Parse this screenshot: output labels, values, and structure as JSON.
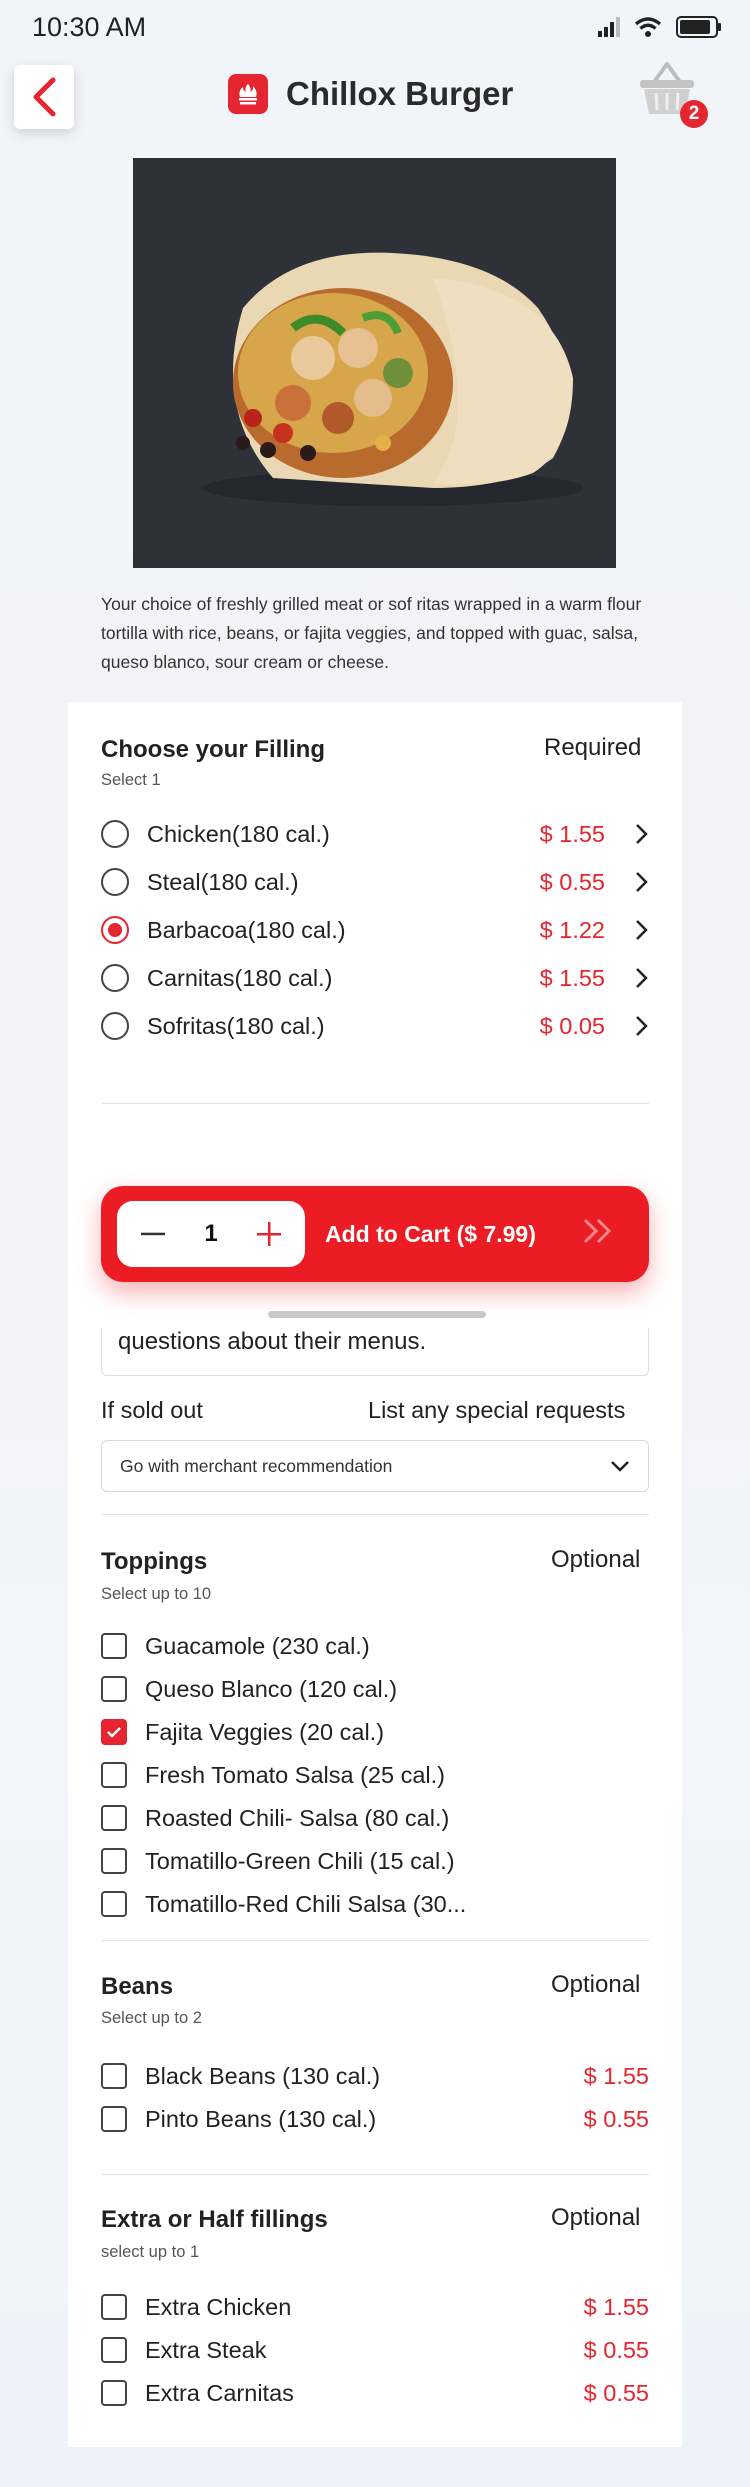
{
  "status": {
    "time": "10:30 AM"
  },
  "header": {
    "title": "Chillox Burger",
    "cart_count": "2"
  },
  "product": {
    "description": "Your choice of freshly grilled meat or sof ritas wrapped in a warm flour tortilla with rice, beans, or fajita veggies, and topped with guac, salsa, queso blanco, sour cream or cheese."
  },
  "filling": {
    "title": "Choose your Filling",
    "subtitle": "Select 1",
    "tag": "Required",
    "options": [
      {
        "label": "Chicken(180 cal.)",
        "price": "$ 1.55",
        "selected": false
      },
      {
        "label": "Steal(180 cal.)",
        "price": "$ 0.55",
        "selected": false
      },
      {
        "label": "Barbacoa(180 cal.)",
        "price": "$ 1.22",
        "selected": true
      },
      {
        "label": "Carnitas(180 cal.)",
        "price": "$ 1.55",
        "selected": false
      },
      {
        "label": "Sofritas(180 cal.)",
        "price": "$ 0.05",
        "selected": false
      }
    ]
  },
  "cart_bar": {
    "quantity": "1",
    "add_label": "Add to Cart ($ 7.99)"
  },
  "notes": {
    "text": "questions about their menus."
  },
  "sold_out": {
    "label": "If sold out",
    "requests_label": "List any special requests",
    "value": "Go with merchant recommendation"
  },
  "toppings": {
    "title": "Toppings",
    "subtitle": "Select up to 10",
    "tag": "Optional",
    "options": [
      {
        "label": "Guacamole (230 cal.)",
        "checked": false
      },
      {
        "label": "Queso Blanco (120 cal.)",
        "checked": false
      },
      {
        "label": "Fajita Veggies (20 cal.)",
        "checked": true
      },
      {
        "label": "Fresh Tomato Salsa (25 cal.)",
        "checked": false
      },
      {
        "label": "Roasted Chili- Salsa (80 cal.)",
        "checked": false
      },
      {
        "label": "Tomatillo-Green Chili (15 cal.)",
        "checked": false
      },
      {
        "label": "Tomatillo-Red Chili Salsa (30...",
        "checked": false
      }
    ]
  },
  "beans": {
    "title": "Beans",
    "subtitle": "Select up to 2",
    "tag": "Optional",
    "options": [
      {
        "label": "Black Beans (130 cal.)",
        "price": "$ 1.55"
      },
      {
        "label": "Pinto Beans (130 cal.)",
        "price": "$ 0.55"
      }
    ]
  },
  "extra": {
    "title": "Extra or Half fillings",
    "subtitle": "select up to 1",
    "tag": "Optional",
    "options": [
      {
        "label": "Extra Chicken",
        "price": "$ 1.55"
      },
      {
        "label": "Extra Steak",
        "price": "$ 0.55"
      },
      {
        "label": "Extra Carnitas",
        "price": "$ 0.55"
      }
    ]
  },
  "colors": {
    "accent": "#e5252f",
    "cart_bar": "#ec1c24"
  }
}
